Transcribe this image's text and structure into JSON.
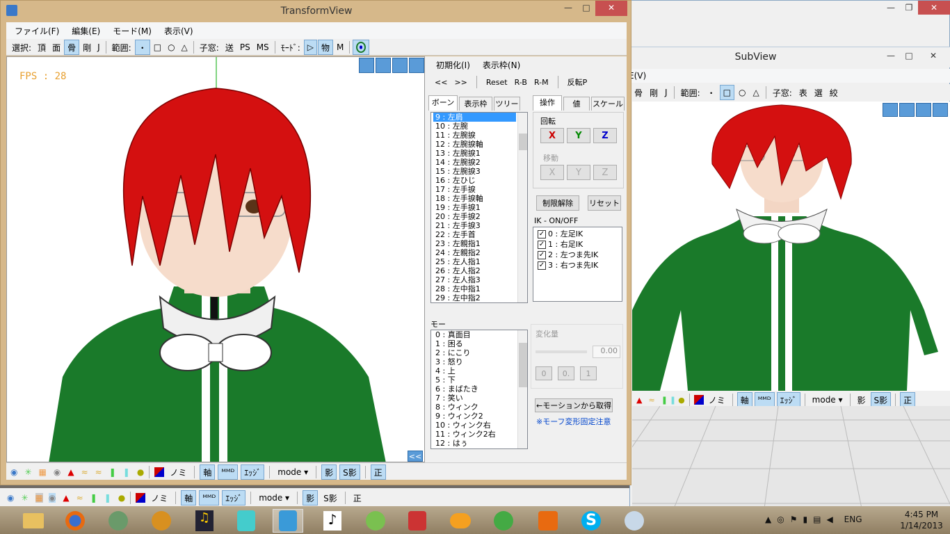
{
  "main_window": {
    "title": "TransformView",
    "menu": [
      "ファイル(F)",
      "編集(E)",
      "モード(M)",
      "表示(V)"
    ],
    "toolbar": {
      "select_label": "選択:",
      "select_items": [
        "頂",
        "面",
        "骨",
        "剛",
        "J"
      ],
      "range_label": "範囲:",
      "range_items": [
        "・",
        "□",
        "○",
        "△"
      ],
      "child_label": "子窓:",
      "child_items": [
        "送",
        "PS",
        "MS"
      ],
      "mode_label": "ﾓｰﾄﾞ:",
      "mode_items": [
        "▷",
        "物",
        "M"
      ]
    },
    "fps": "FPS : 28",
    "collapse_btn": "<<"
  },
  "panel": {
    "menu": [
      "初期化(I)",
      "表示枠(N)"
    ],
    "nav": [
      "<<",
      ">>",
      "Reset",
      "R-B",
      "R-M",
      "反転P"
    ],
    "bone_tabs": [
      "ボーン",
      "表示枠",
      "ツリー"
    ],
    "bones": [
      "9 : 左肩",
      "10 : 左腕",
      "11 : 左腕捩",
      "12 : 左腕捩軸",
      "13 : 左腕捩1",
      "14 : 左腕捩2",
      "15 : 左腕捩3",
      "16 : 左ひじ",
      "17 : 左手捩",
      "18 : 左手捩軸",
      "19 : 左手捩1",
      "20 : 左手捩2",
      "21 : 左手捩3",
      "22 : 左手首",
      "23 : 左親指1",
      "24 : 左親指2",
      "25 : 左人指1",
      "26 : 左人指2",
      "27 : 左人指3",
      "28 : 左中指1",
      "29 : 左中指2"
    ],
    "op_tabs": [
      "操作",
      "値",
      "スケール"
    ],
    "rotate_label": "回転",
    "rotate_axes": [
      "X",
      "Y",
      "Z"
    ],
    "move_label": "移動",
    "move_axes": [
      "X",
      "Y",
      "Z"
    ],
    "limit_btn": "制限解除",
    "reset_btn": "リセット",
    "ik_label": "IK - ON/OFF",
    "ik_items": [
      "0 : 左足IK",
      "1 : 右足IK",
      "2 : 左つま先IK",
      "3 : 右つま先IK"
    ],
    "morph_label": "モー",
    "morphs": [
      "0 : 真面目",
      "1 : 困る",
      "2 : にこり",
      "3 : 怒り",
      "4 : 上",
      "5 : 下",
      "6 : まばたき",
      "7 : 笑い",
      "8 : ウィンク",
      "9 : ウィンク2",
      "10 : ウィンク右",
      "11 : ウィンク2右",
      "12 : はぅ"
    ],
    "change_label": "変化量",
    "change_value": "0.00",
    "change_btns": [
      "0",
      "0.",
      "1"
    ],
    "from_motion_btn": "←モーションから取得",
    "note": "※モーフ変形固定注意"
  },
  "bottombar": {
    "nomi": "ノミ",
    "axis": "軸",
    "mo": "ᴹᴹᴰ",
    "edge": "ｴｯｼﾞ",
    "mode": "mode",
    "shadow": "影",
    "sshadow": "S影",
    "sei": "正"
  },
  "subview": {
    "title": "SubView",
    "menu_partial": "E(V)",
    "toolbar": [
      "骨",
      "剛",
      "J",
      "範囲:",
      "・",
      "□",
      "○",
      "△",
      "子窓:",
      "表",
      "選",
      "絞"
    ]
  },
  "taskbar": {
    "lang": "ENG",
    "time": "4:45 PM",
    "date": "1/14/2013"
  },
  "colors": {
    "accent": "#3399ff",
    "frame": "#d6b88a",
    "fps": "#e8a030",
    "hair": "#d41010",
    "jacket": "#1a7a2a"
  }
}
